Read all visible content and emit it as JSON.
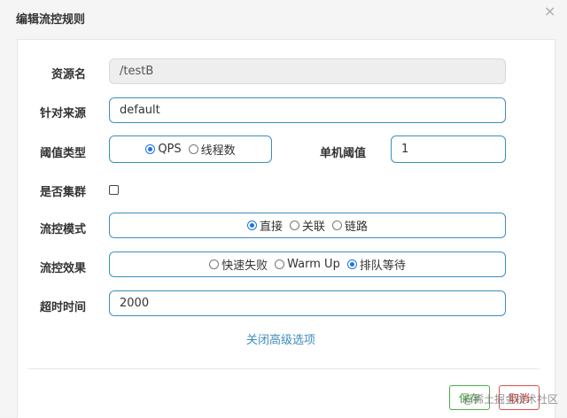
{
  "dialog": {
    "title": "编辑流控规则",
    "close_icon": "×"
  },
  "form": {
    "resource": {
      "label": "资源名",
      "value": "/testB"
    },
    "limit_app": {
      "label": "针对来源",
      "value": "default"
    },
    "threshold_type": {
      "label": "阈值类型",
      "options": [
        "QPS",
        "线程数"
      ],
      "selected": "QPS"
    },
    "single_threshold": {
      "label": "单机阈值",
      "value": "1"
    },
    "cluster": {
      "label": "是否集群",
      "checked": false
    },
    "strategy": {
      "label": "流控模式",
      "options": [
        "直接",
        "关联",
        "链路"
      ],
      "selected": "直接"
    },
    "control_behavior": {
      "label": "流控效果",
      "options": [
        "快速失败",
        "Warm Up",
        "排队等待"
      ],
      "selected": "排队等待"
    },
    "timeout": {
      "label": "超时时间",
      "value": "2000"
    },
    "advanced_toggle": "关闭高级选项"
  },
  "footer": {
    "save_label": "保存",
    "cancel_label": "取消"
  },
  "watermark": "@稀土掘金技术社区",
  "colors": {
    "accent": "#3c8dbc",
    "radio": "#1a73e8",
    "save": "#4cae4c",
    "cancel": "#d9534f"
  }
}
